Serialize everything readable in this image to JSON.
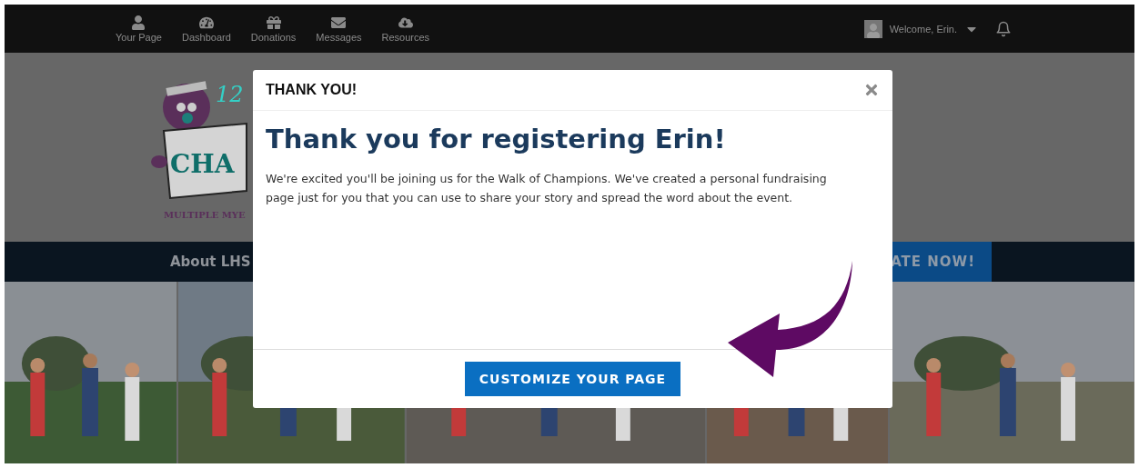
{
  "top_bar": {
    "nav": [
      {
        "label": "Your Page"
      },
      {
        "label": "Dashboard"
      },
      {
        "label": "Donations"
      },
      {
        "label": "Messages"
      },
      {
        "label": "Resources"
      }
    ],
    "welcome": "Welcome, Erin."
  },
  "logo": {
    "number": "12",
    "title": "CHA",
    "subtitle": "MULTIPLE MYE"
  },
  "menu": {
    "items": [
      {
        "label": "About LHS",
        "kind": "link"
      },
      {
        "label": "ATE NOW!",
        "kind": "button"
      }
    ]
  },
  "modal": {
    "header": "THANK YOU!",
    "title": "Thank you for registering Erin!",
    "message": "We're excited you'll be joining us for the Walk of Champions. We've created a personal fundraising page just for you that you can use to share your story and spread the word about the event.",
    "button": "CUSTOMIZE YOUR PAGE"
  }
}
